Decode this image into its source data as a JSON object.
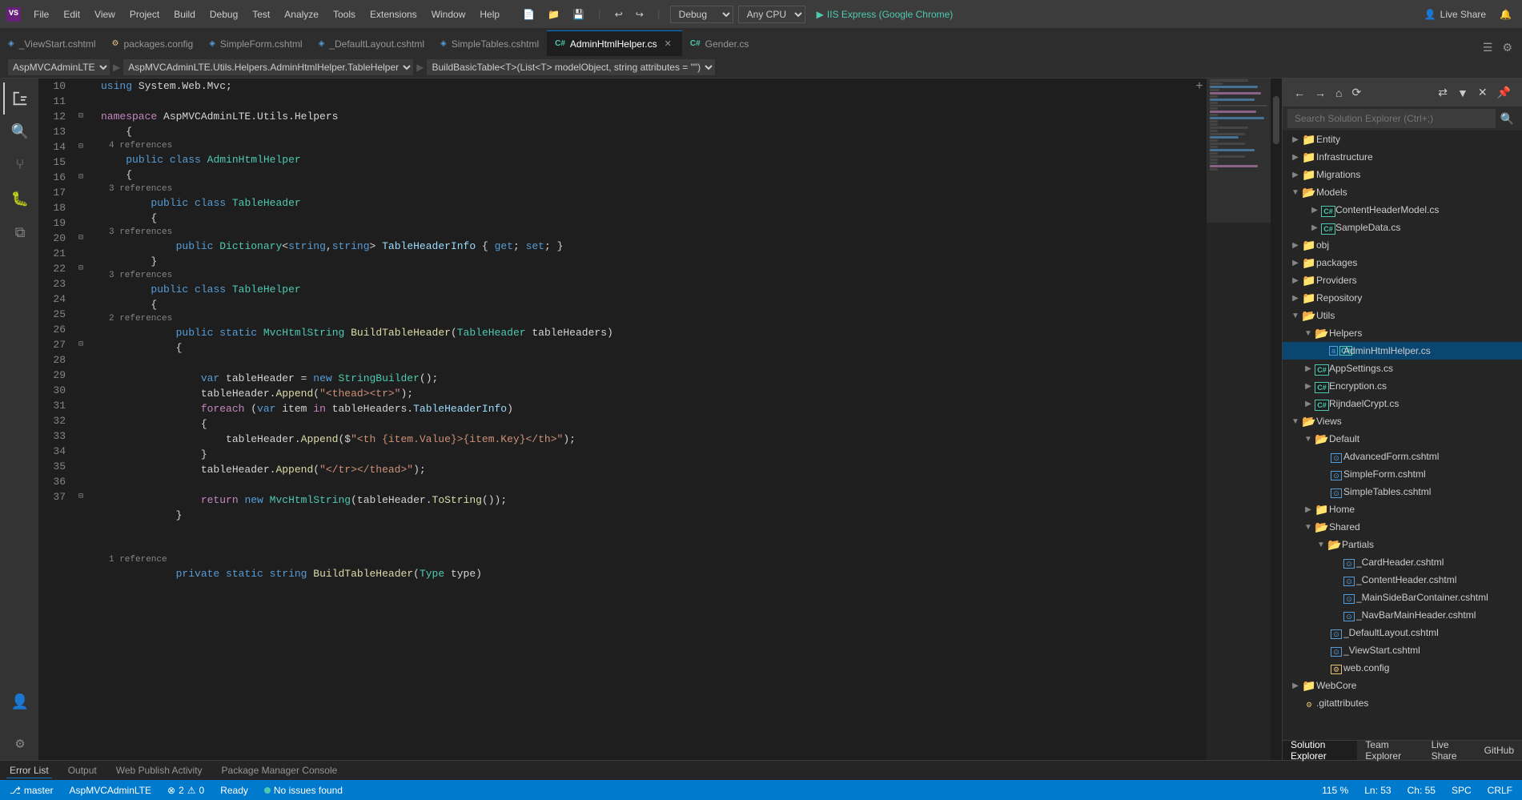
{
  "titleBar": {
    "appIcon": "VS",
    "menus": [
      "File",
      "Edit",
      "View",
      "Project",
      "Build",
      "Debug",
      "Test",
      "Analyze",
      "Tools",
      "Extensions",
      "Window",
      "Help"
    ],
    "debugMode": "Debug",
    "platform": "Any CPU",
    "runLabel": "IIS Express (Google Chrome)",
    "liveShare": "Live Share"
  },
  "tabs": [
    {
      "id": "viewstart",
      "label": "_ViewStart.cshtml",
      "icon": "cshtml",
      "active": false
    },
    {
      "id": "packages",
      "label": "packages.config",
      "icon": "config",
      "active": false
    },
    {
      "id": "simpleform",
      "label": "SimpleForm.cshtml",
      "icon": "cshtml",
      "active": false
    },
    {
      "id": "defaultlayout",
      "label": "_DefaultLayout.cshtml",
      "icon": "cshtml",
      "active": false
    },
    {
      "id": "simpletables",
      "label": "SimpleTables.cshtml",
      "icon": "cshtml",
      "active": false
    },
    {
      "id": "adminhtmlhelper",
      "label": "AdminHtmlHelper.cs",
      "icon": "cs",
      "active": true
    },
    {
      "id": "gender",
      "label": "Gender.cs",
      "icon": "cs",
      "active": false
    }
  ],
  "pathBar": {
    "namespace": "AspMVCAdminLTE",
    "class": "AspMVCAdminLTE.Utils.Helpers.AdminHtmlHelper.TableHelper",
    "method": "BuildBasicTable<T>(List<T> modelObject, string attributes = \"\")"
  },
  "codeLines": [
    {
      "num": 10,
      "indent": 0,
      "tokens": [
        {
          "t": "kw",
          "v": "using"
        },
        {
          "t": "plain",
          "v": " System.Web.Mvc;"
        }
      ]
    },
    {
      "num": 11,
      "indent": 0,
      "tokens": []
    },
    {
      "num": 12,
      "indent": 0,
      "tokens": [
        {
          "t": "kw2",
          "v": "namespace"
        },
        {
          "t": "plain",
          "v": " AspMVCAdminLTE.Utils.Helpers"
        }
      ]
    },
    {
      "num": 13,
      "indent": 0,
      "tokens": [
        {
          "t": "plain",
          "v": "    {"
        }
      ]
    },
    {
      "num": 14,
      "indent": 1,
      "refCount": "4 references",
      "tokens": [
        {
          "t": "plain",
          "v": "    "
        },
        {
          "t": "kw",
          "v": "public"
        },
        {
          "t": "plain",
          "v": " "
        },
        {
          "t": "kw",
          "v": "class"
        },
        {
          "t": "plain",
          "v": " "
        },
        {
          "t": "type",
          "v": "AdminHtmlHelper"
        }
      ]
    },
    {
      "num": 15,
      "indent": 1,
      "tokens": [
        {
          "t": "plain",
          "v": "    {"
        }
      ]
    },
    {
      "num": 16,
      "indent": 2,
      "refCount": "3 references",
      "tokens": [
        {
          "t": "plain",
          "v": "        "
        },
        {
          "t": "kw",
          "v": "public"
        },
        {
          "t": "plain",
          "v": " "
        },
        {
          "t": "kw",
          "v": "class"
        },
        {
          "t": "plain",
          "v": " "
        },
        {
          "t": "type",
          "v": "TableHeader"
        }
      ]
    },
    {
      "num": 17,
      "indent": 2,
      "tokens": [
        {
          "t": "plain",
          "v": "        {"
        }
      ]
    },
    {
      "num": 18,
      "indent": 3,
      "refCount": "3 references",
      "tokens": [
        {
          "t": "plain",
          "v": "            "
        },
        {
          "t": "kw",
          "v": "public"
        },
        {
          "t": "plain",
          "v": " "
        },
        {
          "t": "type",
          "v": "Dictionary"
        },
        {
          "t": "plain",
          "v": "<"
        },
        {
          "t": "kw",
          "v": "string"
        },
        {
          "t": "plain",
          "v": ","
        },
        {
          "t": "kw",
          "v": "string"
        },
        {
          "t": "plain",
          "v": "> "
        },
        {
          "t": "prop",
          "v": "TableHeaderInfo"
        },
        {
          "t": "plain",
          "v": " { "
        },
        {
          "t": "kw",
          "v": "get"
        },
        {
          "t": "plain",
          "v": "; "
        },
        {
          "t": "kw",
          "v": "set"
        },
        {
          "t": "plain",
          "v": "; }"
        }
      ]
    },
    {
      "num": 19,
      "indent": 2,
      "tokens": [
        {
          "t": "plain",
          "v": "        }"
        }
      ]
    },
    {
      "num": 20,
      "indent": 2,
      "refCount": "3 references",
      "tokens": [
        {
          "t": "plain",
          "v": "        "
        },
        {
          "t": "kw",
          "v": "public"
        },
        {
          "t": "plain",
          "v": " "
        },
        {
          "t": "kw",
          "v": "class"
        },
        {
          "t": "plain",
          "v": " "
        },
        {
          "t": "type",
          "v": "TableHelper"
        }
      ]
    },
    {
      "num": 21,
      "indent": 2,
      "tokens": [
        {
          "t": "plain",
          "v": "        {"
        }
      ]
    },
    {
      "num": 22,
      "indent": 3,
      "refCount": "2 references",
      "tokens": [
        {
          "t": "plain",
          "v": "            "
        },
        {
          "t": "kw",
          "v": "public"
        },
        {
          "t": "plain",
          "v": " "
        },
        {
          "t": "kw",
          "v": "static"
        },
        {
          "t": "plain",
          "v": " "
        },
        {
          "t": "type",
          "v": "MvcHtmlString"
        },
        {
          "t": "plain",
          "v": " "
        },
        {
          "t": "method",
          "v": "BuildTableHeader"
        },
        {
          "t": "plain",
          "v": "("
        },
        {
          "t": "type",
          "v": "TableHeader"
        },
        {
          "t": "plain",
          "v": " tableHeaders)"
        }
      ]
    },
    {
      "num": 23,
      "indent": 3,
      "tokens": [
        {
          "t": "plain",
          "v": "            {"
        }
      ]
    },
    {
      "num": 24,
      "indent": 4,
      "tokens": []
    },
    {
      "num": 25,
      "indent": 4,
      "tokens": [
        {
          "t": "plain",
          "v": "                "
        },
        {
          "t": "kw",
          "v": "var"
        },
        {
          "t": "plain",
          "v": " tableHeader = "
        },
        {
          "t": "kw",
          "v": "new"
        },
        {
          "t": "plain",
          "v": " "
        },
        {
          "t": "type",
          "v": "StringBuilder"
        },
        {
          "t": "plain",
          "v": "();"
        }
      ]
    },
    {
      "num": 26,
      "indent": 4,
      "tokens": [
        {
          "t": "plain",
          "v": "                tableHeader."
        },
        {
          "t": "method",
          "v": "Append"
        },
        {
          "t": "plain",
          "v": "("
        },
        {
          "t": "str",
          "v": "\"<thead><tr>\""
        },
        {
          "t": "plain",
          "v": ");"
        }
      ]
    },
    {
      "num": 27,
      "indent": 4,
      "tokens": [
        {
          "t": "plain",
          "v": "                "
        },
        {
          "t": "kw2",
          "v": "foreach"
        },
        {
          "t": "plain",
          "v": " ("
        },
        {
          "t": "kw",
          "v": "var"
        },
        {
          "t": "plain",
          "v": " item "
        },
        {
          "t": "kw2",
          "v": "in"
        },
        {
          "t": "plain",
          "v": " tableHeaders."
        },
        {
          "t": "prop",
          "v": "TableHeaderInfo"
        },
        {
          "t": "plain",
          "v": ")"
        }
      ]
    },
    {
      "num": 28,
      "indent": 4,
      "tokens": [
        {
          "t": "plain",
          "v": "                {"
        }
      ]
    },
    {
      "num": 29,
      "indent": 5,
      "tokens": [
        {
          "t": "plain",
          "v": "                    tableHeader."
        },
        {
          "t": "method",
          "v": "Append"
        },
        {
          "t": "plain",
          "v": "($"
        },
        {
          "t": "str",
          "v": "\"<th {item.Value}>{item.Key}</th>\""
        },
        {
          "t": "plain",
          "v": ");"
        }
      ]
    },
    {
      "num": 30,
      "indent": 4,
      "tokens": [
        {
          "t": "plain",
          "v": "                }"
        }
      ]
    },
    {
      "num": 31,
      "indent": 4,
      "tokens": [
        {
          "t": "plain",
          "v": "                tableHeader."
        },
        {
          "t": "method",
          "v": "Append"
        },
        {
          "t": "plain",
          "v": "("
        },
        {
          "t": "str",
          "v": "\"</tr></thead>\""
        },
        {
          "t": "plain",
          "v": ");"
        }
      ]
    },
    {
      "num": 32,
      "indent": 4,
      "tokens": []
    },
    {
      "num": 33,
      "indent": 4,
      "tokens": [
        {
          "t": "plain",
          "v": "                "
        },
        {
          "t": "kw2",
          "v": "return"
        },
        {
          "t": "plain",
          "v": " "
        },
        {
          "t": "kw",
          "v": "new"
        },
        {
          "t": "plain",
          "v": " "
        },
        {
          "t": "type",
          "v": "MvcHtmlString"
        },
        {
          "t": "plain",
          "v": "(tableHeader."
        },
        {
          "t": "method",
          "v": "ToString"
        },
        {
          "t": "plain",
          "v": "());"
        }
      ]
    },
    {
      "num": 34,
      "indent": 3,
      "tokens": [
        {
          "t": "plain",
          "v": "            }"
        }
      ]
    },
    {
      "num": 35,
      "indent": 3,
      "tokens": []
    },
    {
      "num": 36,
      "indent": 3,
      "tokens": []
    },
    {
      "num": 37,
      "indent": 3,
      "refCount": "1 reference",
      "tokens": [
        {
          "t": "plain",
          "v": "            "
        },
        {
          "t": "kw",
          "v": "private"
        },
        {
          "t": "plain",
          "v": " "
        },
        {
          "t": "kw",
          "v": "static"
        },
        {
          "t": "plain",
          "v": " "
        },
        {
          "t": "kw",
          "v": "string"
        },
        {
          "t": "plain",
          "v": " "
        },
        {
          "t": "method",
          "v": "BuildTableHeader"
        },
        {
          "t": "plain",
          "v": "("
        },
        {
          "t": "type",
          "v": "Type"
        },
        {
          "t": "plain",
          "v": " type)"
        }
      ]
    }
  ],
  "solutionExplorer": {
    "title": "Solution Explorer",
    "searchPlaceholder": "Search Solution Explorer (Ctrl+;)",
    "tree": [
      {
        "level": 0,
        "expand": "▶",
        "icon": "folder",
        "label": "Entity",
        "id": "entity"
      },
      {
        "level": 0,
        "expand": "▶",
        "icon": "folder",
        "label": "Infrastructure",
        "id": "infrastructure"
      },
      {
        "level": 0,
        "expand": "▶",
        "icon": "folder",
        "label": "Migrations",
        "id": "migrations"
      },
      {
        "level": 0,
        "expand": "▼",
        "icon": "folder",
        "label": "Models",
        "id": "models"
      },
      {
        "level": 1,
        "expand": "▶",
        "icon": "cs",
        "label": "ContentHeaderModel.cs",
        "id": "contentheadermodel"
      },
      {
        "level": 1,
        "expand": "▶",
        "icon": "cs",
        "label": "SampleData.cs",
        "id": "sampledata"
      },
      {
        "level": 0,
        "expand": "▶",
        "icon": "folder",
        "label": "obj",
        "id": "obj"
      },
      {
        "level": 0,
        "expand": "▶",
        "icon": "folder",
        "label": "packages",
        "id": "packages"
      },
      {
        "level": 0,
        "expand": "▶",
        "icon": "folder",
        "label": "Providers",
        "id": "providers"
      },
      {
        "level": 0,
        "expand": "▶",
        "icon": "folder",
        "label": "Repository",
        "id": "repository"
      },
      {
        "level": 0,
        "expand": "▼",
        "icon": "folder",
        "label": "Utils",
        "id": "utils"
      },
      {
        "level": 1,
        "expand": "▼",
        "icon": "folder",
        "label": "Helpers",
        "id": "helpers"
      },
      {
        "level": 2,
        "expand": " ",
        "icon": "cs",
        "label": "AdminHtmlHelper.cs",
        "id": "adminhtmlhelper",
        "selected": true
      },
      {
        "level": 1,
        "expand": "▶",
        "icon": "cs",
        "label": "AppSettings.cs",
        "id": "appsettings"
      },
      {
        "level": 1,
        "expand": "▶",
        "icon": "cs",
        "label": "Encryption.cs",
        "id": "encryption"
      },
      {
        "level": 1,
        "expand": "▶",
        "icon": "cs",
        "label": "RijndaelCrypt.cs",
        "id": "rijndaelcrypt"
      },
      {
        "level": 0,
        "expand": "▼",
        "icon": "folder",
        "label": "Views",
        "id": "views"
      },
      {
        "level": 1,
        "expand": "▼",
        "icon": "folder",
        "label": "Default",
        "id": "default"
      },
      {
        "level": 2,
        "expand": " ",
        "icon": "cshtml",
        "label": "AdvancedForm.cshtml",
        "id": "advancedform"
      },
      {
        "level": 2,
        "expand": " ",
        "icon": "cshtml",
        "label": "SimpleForm.cshtml",
        "id": "simpleformview"
      },
      {
        "level": 2,
        "expand": " ",
        "icon": "cshtml",
        "label": "SimpleTables.cshtml",
        "id": "simpletablesview"
      },
      {
        "level": 1,
        "expand": "▶",
        "icon": "folder",
        "label": "Home",
        "id": "home"
      },
      {
        "level": 1,
        "expand": "▼",
        "icon": "folder",
        "label": "Shared",
        "id": "shared"
      },
      {
        "level": 2,
        "expand": "▼",
        "icon": "folder",
        "label": "Partials",
        "id": "partials"
      },
      {
        "level": 3,
        "expand": " ",
        "icon": "cshtml",
        "label": "_CardHeader.cshtml",
        "id": "cardheader"
      },
      {
        "level": 3,
        "expand": " ",
        "icon": "cshtml",
        "label": "_ContentHeader.cshtml",
        "id": "contentheader"
      },
      {
        "level": 3,
        "expand": " ",
        "icon": "cshtml",
        "label": "_MainSideBarContainer.cshtml",
        "id": "mainsidebar"
      },
      {
        "level": 3,
        "expand": " ",
        "icon": "cshtml",
        "label": "_NavBarMainHeader.cshtml",
        "id": "navbarmain"
      },
      {
        "level": 2,
        "expand": " ",
        "icon": "cshtml",
        "label": "_DefaultLayout.cshtml",
        "id": "defaultlayoutview"
      },
      {
        "level": 2,
        "expand": " ",
        "icon": "cshtml",
        "label": "_ViewStart.cshtml",
        "id": "viewstartview"
      },
      {
        "level": 2,
        "expand": " ",
        "icon": "config",
        "label": "web.config",
        "id": "webconfig"
      },
      {
        "level": 0,
        "expand": "▶",
        "icon": "folder",
        "label": "WebCore",
        "id": "webcore"
      },
      {
        "level": 0,
        "expand": " ",
        "icon": "config",
        "label": ".gitattributes",
        "id": "gitattributes"
      }
    ],
    "bottomTabs": [
      "Solution Explorer",
      "Team Explorer",
      "Live Share",
      "GitHub"
    ]
  },
  "bottomPanels": {
    "tabs": [
      "Error List",
      "Output",
      "Web Publish Activity",
      "Package Manager Console"
    ]
  },
  "statusBar": {
    "repoIcon": "⎇",
    "branch": "master",
    "projectName": "AspMVCAdminLTE",
    "ready": "Ready",
    "noIssues": "No issues found",
    "lineInfo": "Ln: 53",
    "charInfo": "Ch: 55",
    "encoding": "SPC",
    "lineEnding": "CRLF",
    "errorCount": "2",
    "warningCount": "0",
    "zoom": "115 %"
  }
}
